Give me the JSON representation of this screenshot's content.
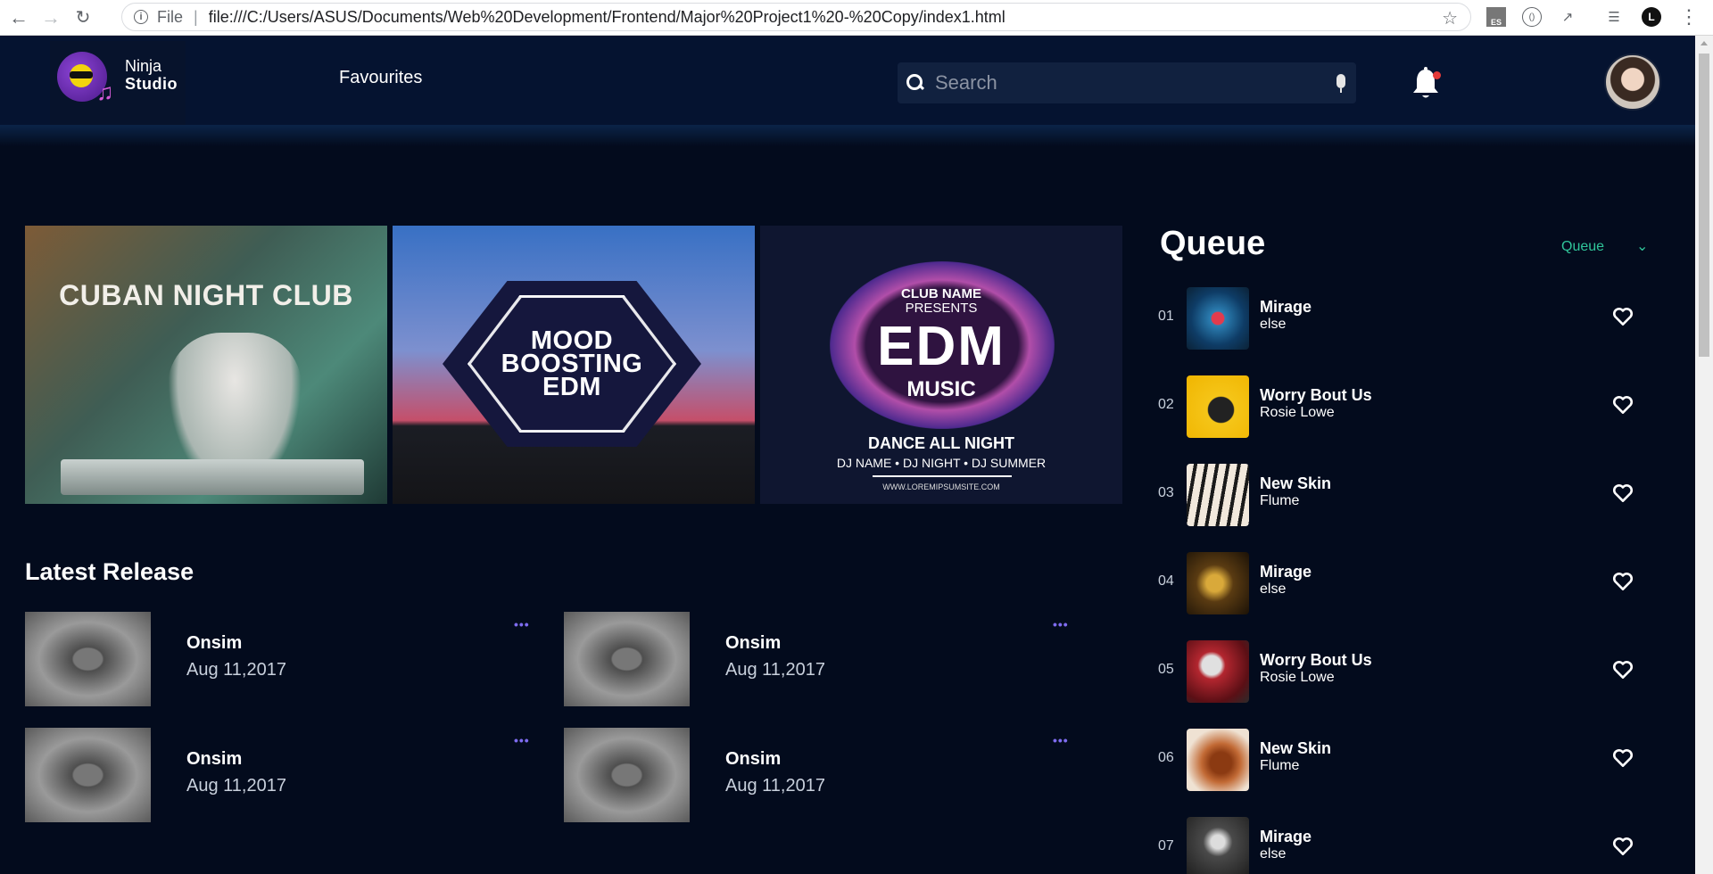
{
  "browser": {
    "scheme_label": "File",
    "url": "file:///C:/Users/ASUS/Documents/Web%20Development/Frontend/Major%20Project1%20-%20Copy/index1.html",
    "nav_icons": [
      "back-arrow",
      "forward-arrow",
      "reload"
    ],
    "ext_es": "ES",
    "profile_initial": "L"
  },
  "header": {
    "logo_line1": "Ninja",
    "logo_line2": "Studio",
    "nav_favourites": "Favourites",
    "search_placeholder": "Search",
    "accent_color": "#30c59a"
  },
  "banners": [
    {
      "title": "CUBAN NIGHT CLUB"
    },
    {
      "line1": "MOOD",
      "line2": "BOOSTING",
      "line3": "EDM"
    },
    {
      "club": "CLUB NAME",
      "presents": "PRESENTS",
      "edm": "EDM",
      "music": "MUSIC",
      "dance": "DANCE ALL NIGHT",
      "djs": "DJ NAME  •  DJ NIGHT  •  DJ SUMMER",
      "site": "WWW.LOREMIPSUMSITE.COM"
    }
  ],
  "latest": {
    "title": "Latest Release",
    "items": [
      {
        "name": "Onsim",
        "date": "Aug 11,2017",
        "more": "•••"
      },
      {
        "name": "Onsim",
        "date": "Aug 11,2017",
        "more": "•••"
      },
      {
        "name": "Onsim",
        "date": "Aug 11,2017",
        "more": "•••"
      },
      {
        "name": "Onsim",
        "date": "Aug 11,2017",
        "more": "•••"
      }
    ]
  },
  "queue": {
    "title": "Queue",
    "select_value": "Queue",
    "items": [
      {
        "num": "01",
        "title": "Mirage",
        "artist": "else"
      },
      {
        "num": "02",
        "title": "Worry Bout Us",
        "artist": "Rosie Lowe"
      },
      {
        "num": "03",
        "title": "New Skin",
        "artist": "Flume"
      },
      {
        "num": "04",
        "title": "Mirage",
        "artist": "else"
      },
      {
        "num": "05",
        "title": "Worry Bout Us",
        "artist": "Rosie Lowe"
      },
      {
        "num": "06",
        "title": "New Skin",
        "artist": "Flume"
      },
      {
        "num": "07",
        "title": "Mirage",
        "artist": "else"
      }
    ]
  }
}
